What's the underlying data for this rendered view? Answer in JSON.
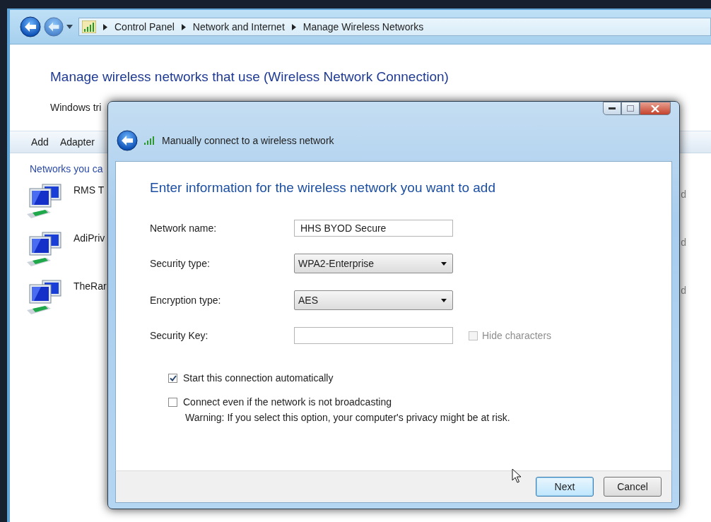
{
  "address_bar": {
    "breadcrumbs": [
      "Control Panel",
      "Network and Internet",
      "Manage Wireless Networks"
    ]
  },
  "page": {
    "title": "Manage wireless networks that use (Wireless Network Connection)",
    "description": "Windows tri",
    "toolbar": [
      "Add",
      "Adapter"
    ],
    "list_heading": "Networks you ca",
    "networks": [
      {
        "name": "RMS T",
        "status": "d"
      },
      {
        "name": "AdiPriv",
        "status": "d"
      },
      {
        "name": "TheRar",
        "status": "d"
      }
    ]
  },
  "dialog": {
    "title": "Manually connect to a wireless network",
    "heading": "Enter information for the wireless network you want to add",
    "fields": [
      {
        "kind": "text",
        "label": "Network name:",
        "value": "HHS BYOD Secure"
      },
      {
        "kind": "select",
        "label": "Security type:",
        "value": "WPA2-Enterprise"
      },
      {
        "kind": "select",
        "label": "Encryption type:",
        "value": "AES"
      },
      {
        "kind": "text",
        "label": "Security Key:",
        "option": {
          "label": "Hide characters",
          "checked": false,
          "disabled": true
        }
      }
    ],
    "options": [
      {
        "label": "Start this connection automatically",
        "checked": true
      },
      {
        "label": "Connect even if the network is not broadcasting",
        "checked": false
      }
    ],
    "warning": "Warning: If you select this option, your computer's privacy might be at risk.",
    "buttons": [
      {
        "label": "Next",
        "default": true
      },
      {
        "label": "Cancel",
        "default": false
      }
    ]
  }
}
